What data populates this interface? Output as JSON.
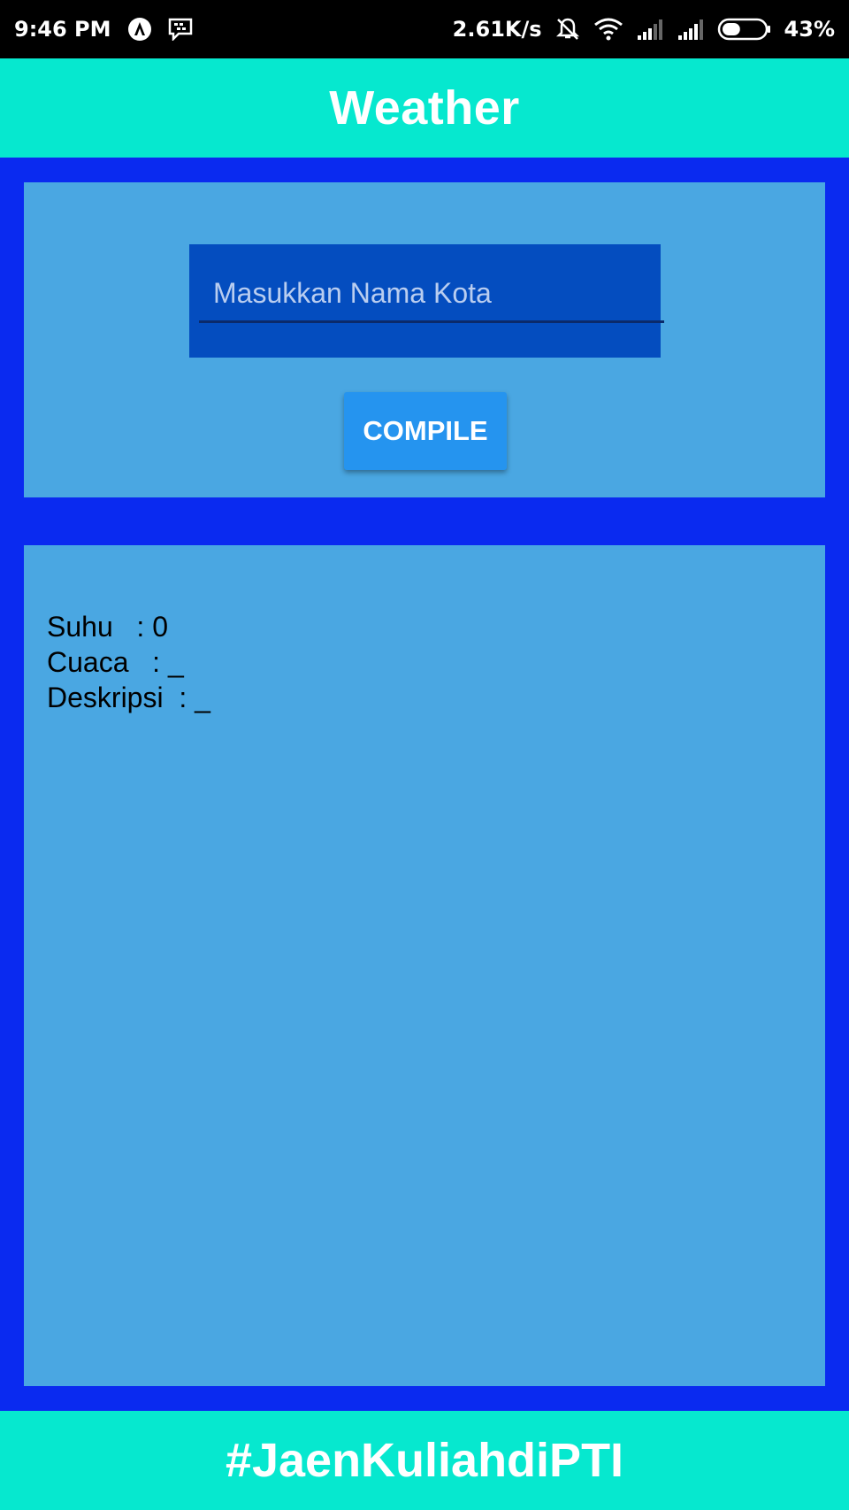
{
  "status_bar": {
    "time": "9:46 PM",
    "network_speed": "2.61K/s",
    "battery_percent": "43%",
    "battery_level": 0.43,
    "left_icons": [
      "app-a-icon",
      "bbm-chat-icon"
    ],
    "right_icons": [
      "muted-bell-icon",
      "wifi-icon",
      "signal-icon",
      "signal-icon",
      "battery-icon"
    ]
  },
  "app_bar": {
    "title": "Weather"
  },
  "input_panel": {
    "city_input_placeholder": "Masukkan Nama Kota",
    "city_input_value": "",
    "compile_label": "COMPILE"
  },
  "result_panel": {
    "rows": [
      {
        "label": "Suhu   ",
        "sep": ": ",
        "value": "0"
      },
      {
        "label": "Cuaca   ",
        "sep": ": ",
        "value": "_"
      },
      {
        "label": "Deskripsi  ",
        "sep": ": ",
        "value": "_"
      }
    ]
  },
  "footer": {
    "text": "#JaenKuliahdiPTI"
  },
  "colors": {
    "teal": "#06e8cf",
    "blue_background": "#0a2af0",
    "panel": "#4aa7e2",
    "input_field": "#044dbf",
    "button": "#2594ef"
  }
}
